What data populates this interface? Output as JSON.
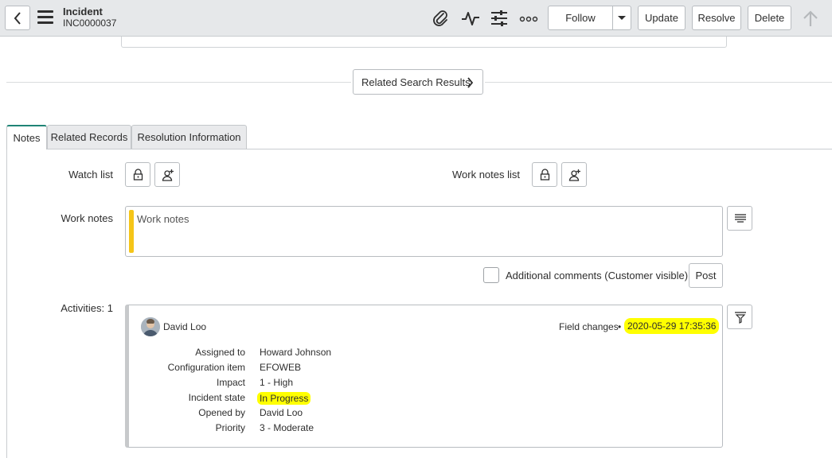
{
  "header": {
    "title": "Incident",
    "number": "INC0000037",
    "follow_label": "Follow",
    "update_label": "Update",
    "resolve_label": "Resolve",
    "delete_label": "Delete"
  },
  "related_search": {
    "label": "Related Search Results"
  },
  "tabs": [
    {
      "label": "Notes"
    },
    {
      "label": "Related Records"
    },
    {
      "label": "Resolution Information"
    }
  ],
  "notes": {
    "watch_list_label": "Watch list",
    "work_notes_list_label": "Work notes list",
    "work_notes_label": "Work notes",
    "work_notes_placeholder": "Work notes",
    "additional_comments_label": "Additional comments (Customer visible)",
    "post_label": "Post",
    "activities_label": "Activities: 1"
  },
  "activity": {
    "author": "David Loo",
    "type": "Field changes",
    "separator": "•",
    "timestamp": "2020-05-29 17:35:36",
    "fields": [
      {
        "name": "Assigned to",
        "value": "Howard Johnson"
      },
      {
        "name": "Configuration item",
        "value": "EFOWEB"
      },
      {
        "name": "Impact",
        "value": "1 - High"
      },
      {
        "name": "Incident state",
        "value": "In Progress"
      },
      {
        "name": "Opened by",
        "value": "David Loo"
      },
      {
        "name": "Priority",
        "value": "3 - Moderate"
      }
    ]
  },
  "colors": {
    "accent": "#1f8476",
    "highlight": "#ffff00",
    "work_notes_bar": "#f5c518"
  }
}
